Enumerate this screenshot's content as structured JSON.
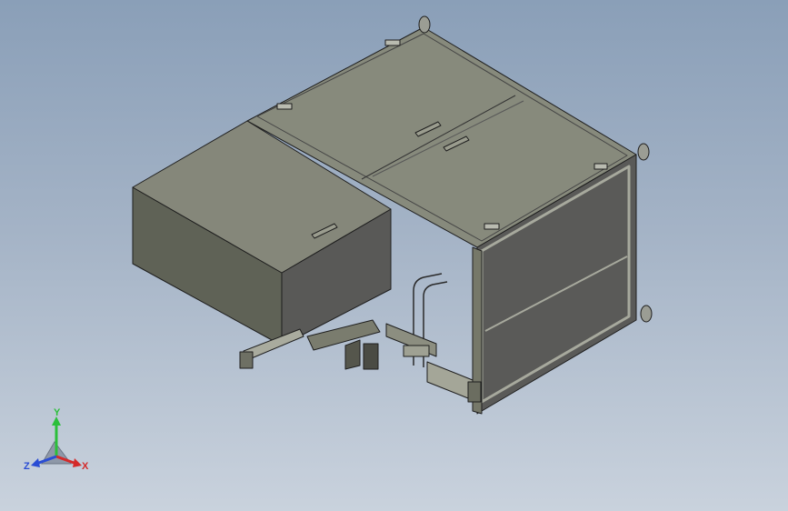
{
  "viewport": {
    "background_top": "#8a9fb8",
    "background_bottom": "#c9d2dd"
  },
  "model": {
    "body_color": "#8a8a7e",
    "edge_color": "#1e1e1e"
  },
  "triad": {
    "x_label": "X",
    "y_label": "Y",
    "z_label": "Z",
    "x_color": "#d42a2a",
    "y_color": "#2bbf3a",
    "z_color": "#2a4dd4"
  }
}
